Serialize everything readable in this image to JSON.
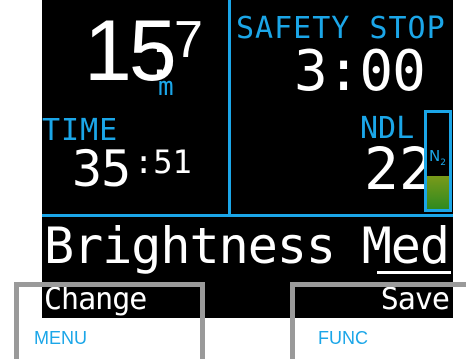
{
  "depth": {
    "whole": "15",
    "separator": ":",
    "decimal": "7",
    "unit": "m"
  },
  "dive_time": {
    "label": "TIME",
    "minutes": "35",
    "seconds": ":51"
  },
  "safety_stop": {
    "label": "SAFETY STOP",
    "countdown": "3:00"
  },
  "ndl": {
    "label": "NDL",
    "value": "22"
  },
  "n2_loading": {
    "label": "N",
    "subscript": "2",
    "fraction": 0.34
  },
  "menu": {
    "title": "Brightness",
    "value": "Med",
    "action_left": "Change",
    "action_right": "Save"
  },
  "buttons": {
    "left": "MENU",
    "right": "FUNC"
  },
  "colors": {
    "accent": "#1ba6e8",
    "text": "#ffffff",
    "screen_background": "#000000",
    "bracket": "#9a9a9a",
    "n2_fill": "#5d8f1c"
  }
}
